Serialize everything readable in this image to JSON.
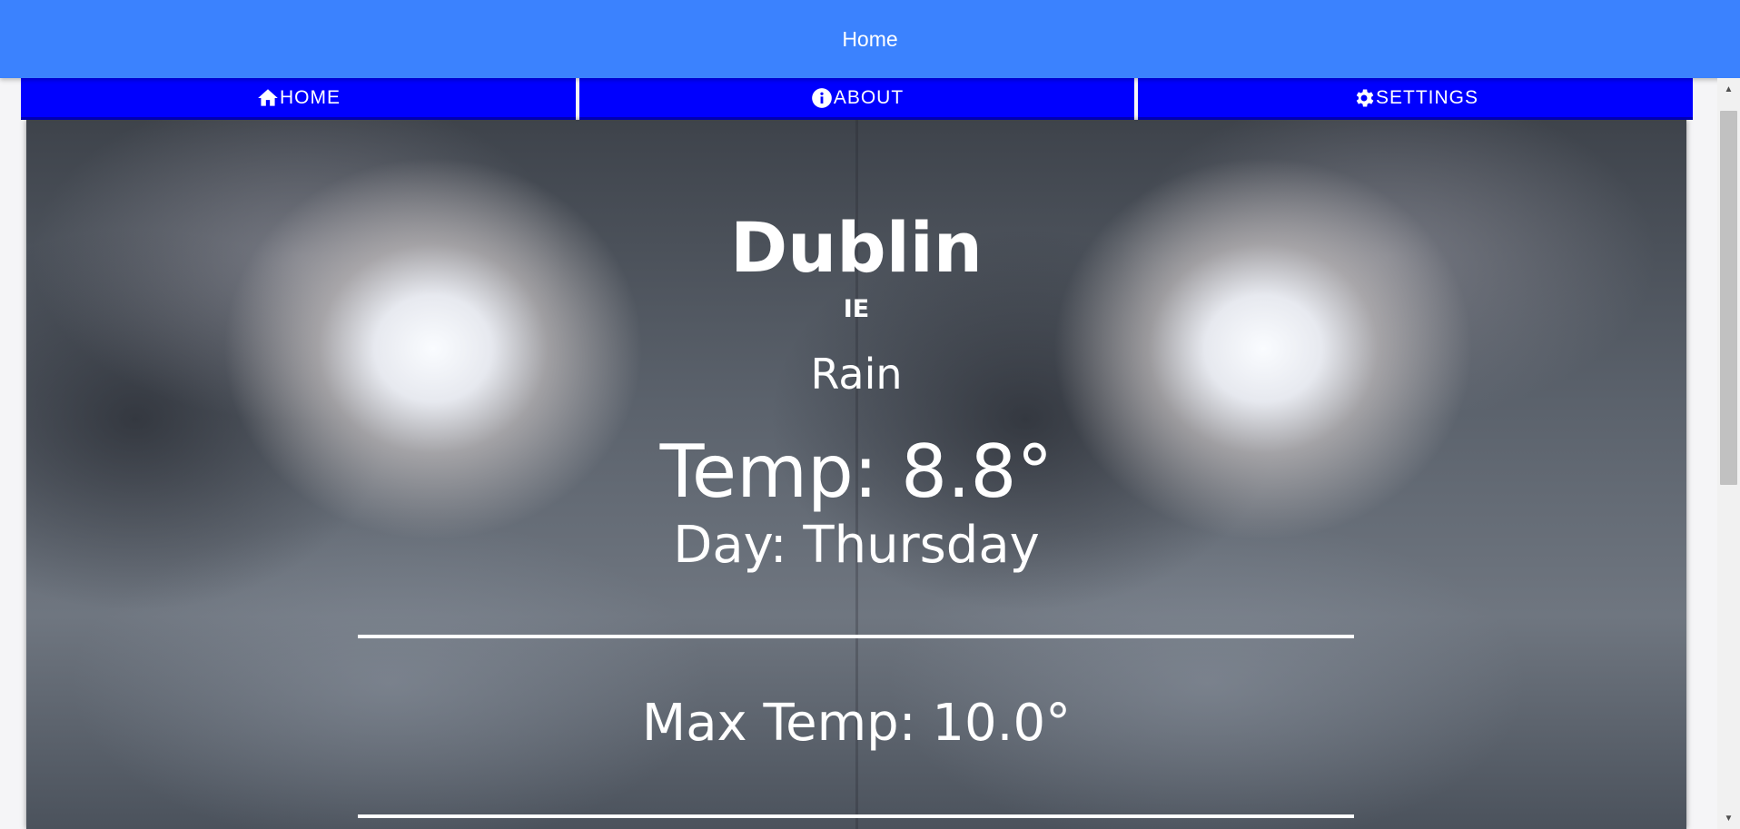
{
  "app_bar": {
    "title": "Home",
    "color": "#3b82fe"
  },
  "nav": {
    "color": "#0000fe",
    "items": [
      {
        "label": "HOME",
        "icon": "home-icon"
      },
      {
        "label": "ABOUT",
        "icon": "info-icon"
      },
      {
        "label": "SETTINGS",
        "icon": "gear-icon"
      }
    ]
  },
  "weather": {
    "city": "Dublin",
    "country": "IE",
    "condition": "Rain",
    "temp": "Temp: 8.8°",
    "day": "Day: Thursday",
    "max_temp": "Max Temp: 10.0°"
  },
  "scrollbar": {
    "up_icon": "arrow-up-icon",
    "down_icon": "arrow-down-icon"
  }
}
